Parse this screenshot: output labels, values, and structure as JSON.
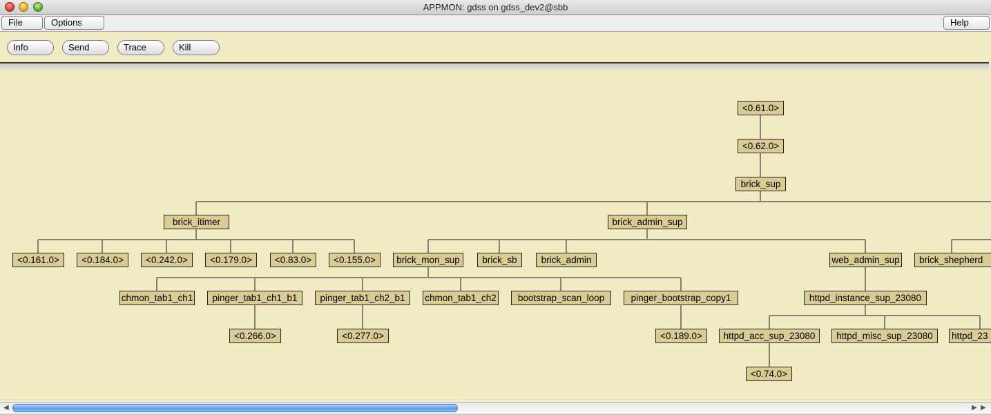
{
  "window": {
    "title": "APPMON: gdss on gdss_dev2@sbb"
  },
  "menu": {
    "file": "File",
    "options": "Options",
    "help": "Help"
  },
  "toolbar": {
    "info": "Info",
    "send": "Send",
    "trace": "Trace",
    "kill": "Kill"
  },
  "tree": {
    "nodes": {
      "p61": "<0.61.0>",
      "p62": "<0.62.0>",
      "brick_sup": "brick_sup",
      "brick_itimer": "brick_itimer",
      "brick_admin_sup": "brick_admin_sup",
      "p161": "<0.161.0>",
      "p184": "<0.184.0>",
      "p242": "<0.242.0>",
      "p179": "<0.179.0>",
      "p83": "<0.83.0>",
      "p155": "<0.155.0>",
      "brick_mon_sup": "brick_mon_sup",
      "brick_sb": "brick_sb",
      "brick_admin": "brick_admin",
      "web_admin_sup": "web_admin_sup",
      "brick_shepherd": "brick_shepherd",
      "chmon_tab1_ch1": "chmon_tab1_ch1",
      "pinger_tab1_ch1_b1": "pinger_tab1_ch1_b1",
      "pinger_tab1_ch2_b1": "pinger_tab1_ch2_b1",
      "chmon_tab1_ch2": "chmon_tab1_ch2",
      "bootstrap_scan_loop": "bootstrap_scan_loop",
      "pinger_bootstrap_copy1": "pinger_bootstrap_copy1",
      "httpd_instance_sup_23080": "httpd_instance_sup_23080",
      "p266": "<0.266.0>",
      "p277": "<0.277.0>",
      "p189": "<0.189.0>",
      "httpd_acc_sup_23080": "httpd_acc_sup_23080",
      "httpd_misc_sup_23080": "httpd_misc_sup_23080",
      "httpd_23": "httpd_23",
      "p74": "<0.74.0>"
    }
  },
  "scroll": {
    "horizontal_position": 0.0
  },
  "colors": {
    "background": "#f2eac2",
    "node_fill": "#d9cc93",
    "edge": "#8a7f6e"
  }
}
